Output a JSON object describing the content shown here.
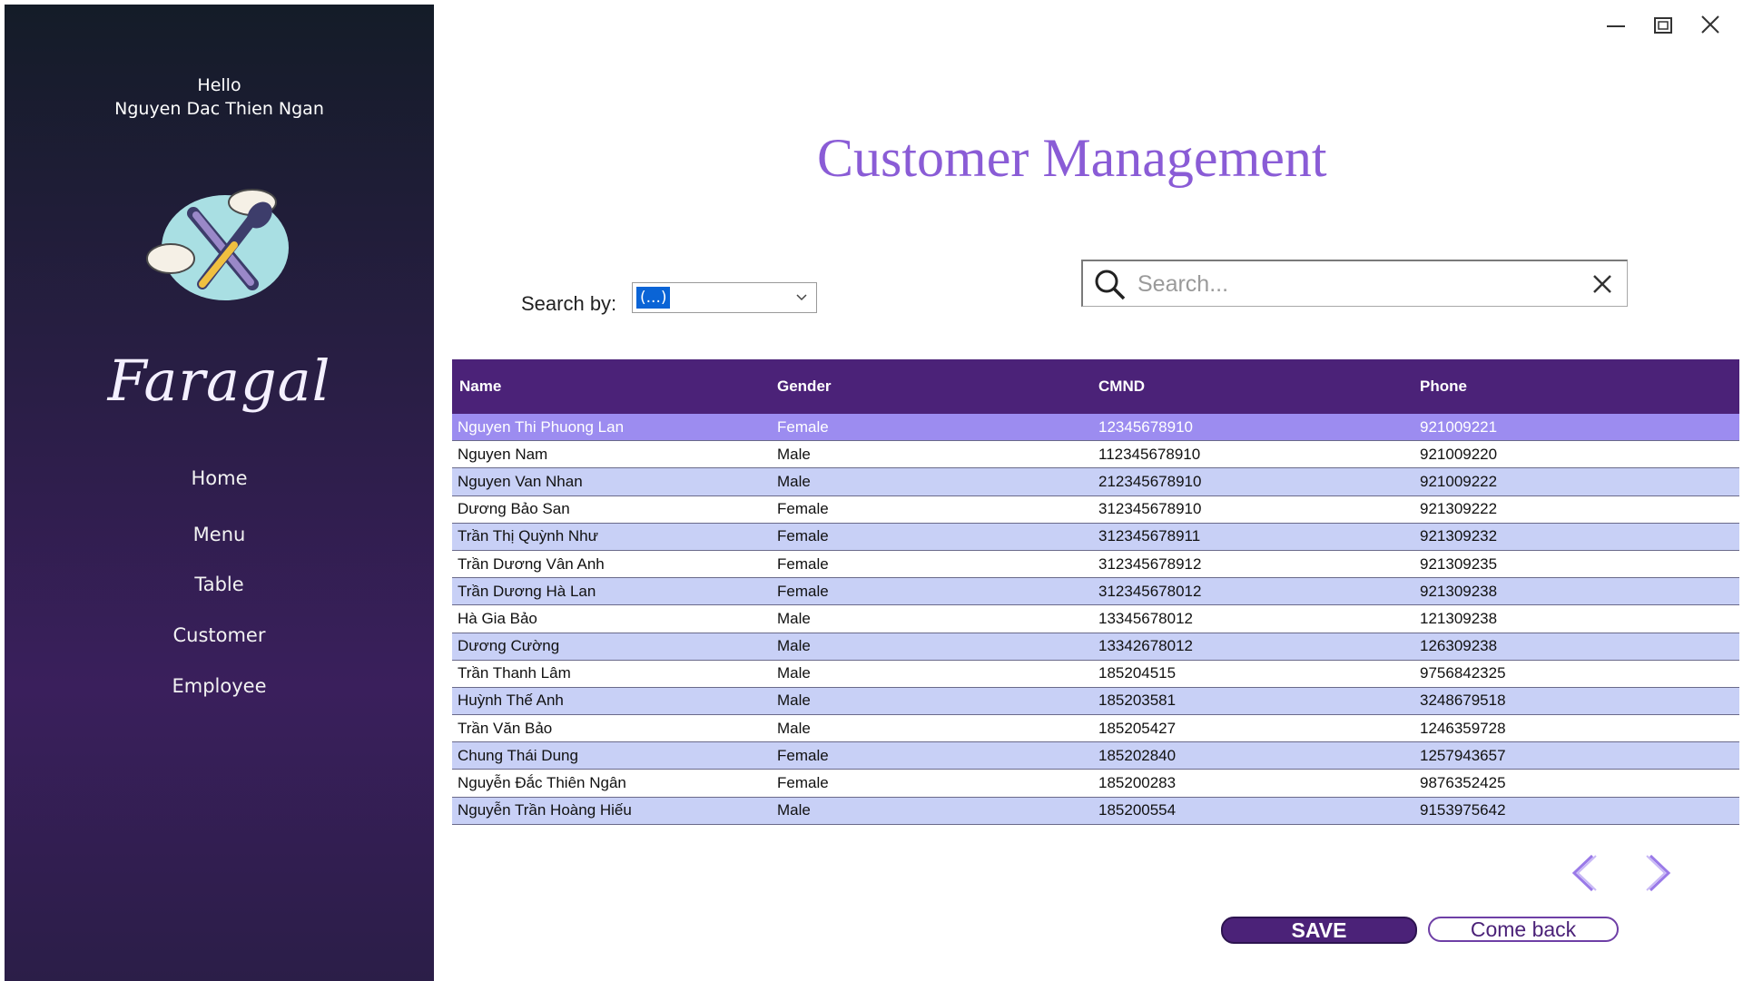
{
  "sidebar": {
    "greeting": "Hello",
    "user_name": "Nguyen Dac Thien Ngan",
    "brand": "Faragal",
    "nav": [
      "Home",
      "Menu",
      "Table",
      "Customer",
      "Employee"
    ]
  },
  "window_controls": {
    "icons": [
      "minimize-icon",
      "restore-icon",
      "close-icon"
    ]
  },
  "page_title": "Customer Management",
  "search_by": {
    "label": "Search by:",
    "selected": "(...)"
  },
  "search": {
    "placeholder": "Search..."
  },
  "table": {
    "columns": [
      "Name",
      "Gender",
      "CMND",
      "Phone"
    ],
    "rows": [
      [
        "Nguyen Thi Phuong Lan",
        "Female",
        "12345678910",
        "921009221"
      ],
      [
        "Nguyen Nam",
        "Male",
        "112345678910",
        "921009220"
      ],
      [
        "Nguyen Van Nhan",
        "Male",
        "212345678910",
        "921009222"
      ],
      [
        "Dương Bảo San",
        "Female",
        "312345678910",
        "921309222"
      ],
      [
        "Trần Thị Quỳnh Như",
        "Female",
        "312345678911",
        "921309232"
      ],
      [
        "Trần Dương Vân Anh",
        "Female",
        "312345678912",
        "921309235"
      ],
      [
        "Trần Dương Hà Lan",
        "Female",
        "312345678012",
        "921309238"
      ],
      [
        "Hà Gia Bảo",
        "Male",
        "13345678012",
        "121309238"
      ],
      [
        "Dương Cường",
        "Male",
        "13342678012",
        "126309238"
      ],
      [
        "Trần Thanh Lâm",
        "Male",
        "185204515",
        "9756842325"
      ],
      [
        "Huỳnh Thế Anh",
        "Male",
        "185203581",
        "3248679518"
      ],
      [
        "Trần Văn Bảo",
        "Male",
        "185205427",
        "1246359728"
      ],
      [
        "Chung Thái Dung",
        "Female",
        "185202840",
        "1257943657"
      ],
      [
        "Nguyễn Đắc Thiên Ngân",
        "Female",
        "185200283",
        "9876352425"
      ],
      [
        "Nguyễn Trần Hoàng Hiếu",
        "Male",
        "185200554",
        "9153975642"
      ]
    ],
    "selected_row": 0
  },
  "buttons": {
    "save": "SAVE",
    "back": "Come back"
  },
  "colors": {
    "header": "#4b2278",
    "row_alt": "#c8d0f6",
    "selected": "#9c8cf0",
    "title": "#8a5cd6"
  }
}
